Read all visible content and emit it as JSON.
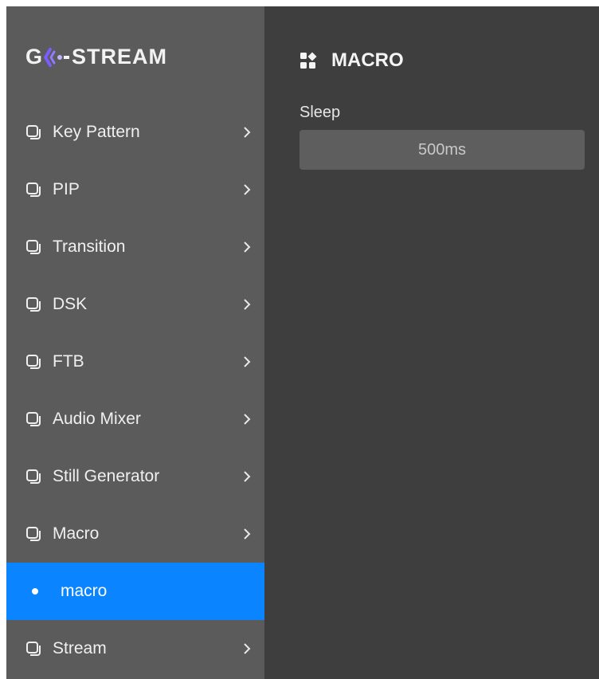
{
  "app": {
    "logo_left": "G",
    "logo_right": "STREAM"
  },
  "sidebar": {
    "items": [
      {
        "label": "Key Pattern",
        "icon": "copy-icon",
        "type": "group"
      },
      {
        "label": "PIP",
        "icon": "copy-icon",
        "type": "group"
      },
      {
        "label": "Transition",
        "icon": "copy-icon",
        "type": "group"
      },
      {
        "label": "DSK",
        "icon": "copy-icon",
        "type": "group"
      },
      {
        "label": "FTB",
        "icon": "copy-icon",
        "type": "group"
      },
      {
        "label": "Audio Mixer",
        "icon": "copy-icon",
        "type": "group"
      },
      {
        "label": "Still Generator",
        "icon": "copy-icon",
        "type": "group"
      },
      {
        "label": "Macro",
        "icon": "copy-icon",
        "type": "group"
      },
      {
        "label": "macro",
        "icon": "dot-icon",
        "type": "subitem-active"
      },
      {
        "label": "Stream",
        "icon": "copy-icon",
        "type": "group"
      }
    ]
  },
  "main": {
    "title": "MACRO",
    "title_icon": "grid-icon",
    "sleep": {
      "label": "Sleep",
      "value": "500ms"
    }
  },
  "colors": {
    "sidebar_bg": "#5b5b5b",
    "main_bg": "#3e3e3e",
    "active": "#0a84ff",
    "logo_accent": "#6b4eff"
  }
}
